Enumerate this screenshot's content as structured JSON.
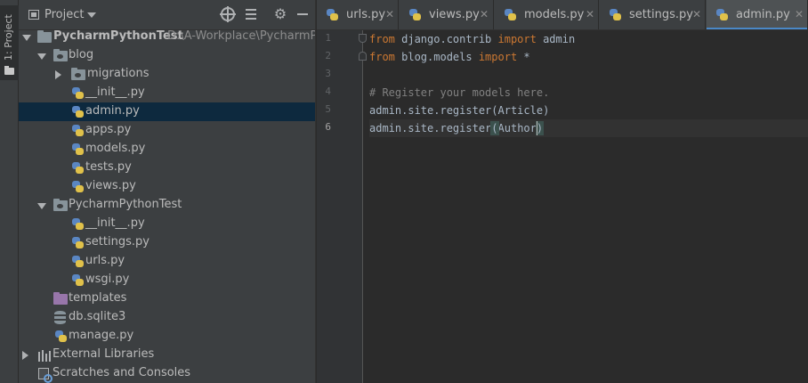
{
  "toolwindow": {
    "project_label": "1: Project"
  },
  "project_panel": {
    "title": "Project",
    "tree": [
      {
        "label": "PycharmPythonTest",
        "path": "D:\\A-Workplace\\PycharmPyth",
        "type": "root"
      },
      {
        "label": "blog",
        "type": "package"
      },
      {
        "label": "migrations",
        "type": "package"
      },
      {
        "label": "__init__.py",
        "type": "py"
      },
      {
        "label": "admin.py",
        "type": "py",
        "selected": true
      },
      {
        "label": "apps.py",
        "type": "py"
      },
      {
        "label": "models.py",
        "type": "py"
      },
      {
        "label": "tests.py",
        "type": "py"
      },
      {
        "label": "views.py",
        "type": "py"
      },
      {
        "label": "PycharmPythonTest",
        "type": "package"
      },
      {
        "label": "__init__.py",
        "type": "py"
      },
      {
        "label": "settings.py",
        "type": "py"
      },
      {
        "label": "urls.py",
        "type": "py"
      },
      {
        "label": "wsgi.py",
        "type": "py"
      },
      {
        "label": "templates",
        "type": "folder"
      },
      {
        "label": "db.sqlite3",
        "type": "db"
      },
      {
        "label": "manage.py",
        "type": "py"
      },
      {
        "label": "External Libraries",
        "type": "libraries"
      },
      {
        "label": "Scratches and Consoles",
        "type": "scratches"
      }
    ]
  },
  "editor": {
    "tabs": [
      {
        "label": "urls.py",
        "close": "✕"
      },
      {
        "label": "views.py",
        "close": "✕"
      },
      {
        "label": "models.py",
        "close": "✕"
      },
      {
        "label": "settings.py",
        "close": "✕"
      },
      {
        "label": "admin.py",
        "close": "✕",
        "active": true
      }
    ],
    "line_numbers": [
      "1",
      "2",
      "3",
      "4",
      "5",
      "6"
    ],
    "current_line": 6,
    "code": {
      "l1_kw1": "from",
      "l1_mod": " django.contrib ",
      "l1_kw2": "import",
      "l1_name": " admin",
      "l2_kw1": "from",
      "l2_mod": " blog.models ",
      "l2_kw2": "import",
      "l2_name": " *",
      "l4_comment": "# Register your models here.",
      "l5": "admin.site.register(Article)",
      "l6_pre": "admin.site.register",
      "l6_open": "(",
      "l6_arg": "Author",
      "l6_close": ")"
    }
  },
  "colors": {
    "panel": "#3c3f41",
    "editor_bg": "#2b2b2b",
    "selection": "#0d293e",
    "keyword": "#cc7832",
    "comment": "#808080",
    "text": "#a9b7c6",
    "active_tab_underline": "#4a88c7"
  }
}
